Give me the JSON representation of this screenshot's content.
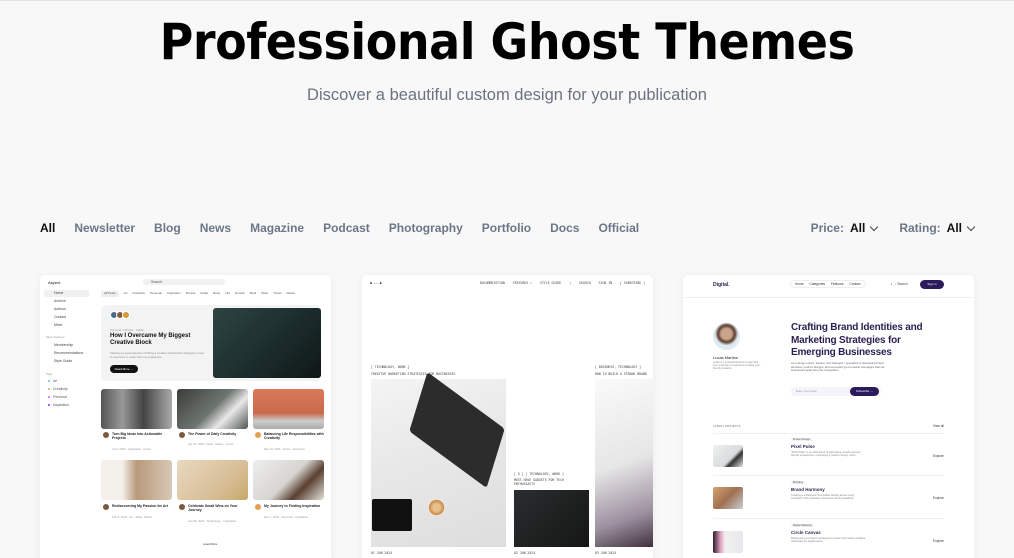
{
  "header": {
    "title": "Professional Ghost Themes",
    "subtitle": "Discover a beautiful custom design for your publication"
  },
  "filters": {
    "categories": [
      "All",
      "Newsletter",
      "Blog",
      "News",
      "Magazine",
      "Podcast",
      "Photography",
      "Portfolio",
      "Docs",
      "Official"
    ],
    "active_category": "All",
    "price": {
      "label": "Price:",
      "value": "All"
    },
    "rating": {
      "label": "Rating:",
      "value": "All"
    }
  },
  "themes": [
    {
      "preview": {
        "logo": "Aspect",
        "search_placeholder": "Search",
        "sidebar": [
          "Home",
          "Archive",
          "Authors",
          "Contact",
          "Mixer"
        ],
        "sidebar_section": "More features",
        "sidebar_features": [
          "Membership",
          "Recommendations",
          "Style Guide"
        ],
        "tags_section": "Tags",
        "tags": [
          "Art",
          "Creativity",
          "Personal",
          "Inspiration"
        ],
        "tabs": [
          "All Posts",
          "Art",
          "Creativity",
          "Personal",
          "Inspiration",
          "Fitness",
          "Dollar",
          "Body",
          "Life",
          "Growth",
          "Mind",
          "Work",
          "Travel",
          "Nature"
        ],
        "featured": {
          "kicker": "Personal · Mindset · Habits",
          "title": "How I Overcame My Biggest Creative Block",
          "desc": "Sharing my personal story of hitting a creative wall and the strategies I used to overcome it. Learn from my experience.",
          "button": "Read More →"
        },
        "posts": [
          {
            "title": "Turn Big Ideas Into Actionable Projects",
            "meta": "Jul 3, 2024 · Inspiration · Focus"
          },
          {
            "title": "The Power of Daily Creativity",
            "meta": "Apr 19, 2024 · Daily · Nature · Focus"
          },
          {
            "title": "Balancing Life Responsibilities with Creativity",
            "meta": "Mar 13, 2024 · Focus · Emotions"
          },
          {
            "title": "Rediscovering My Passion for Art",
            "meta": "Feb 8, 2024 · Art · Skills · Brand"
          },
          {
            "title": "Celebrate Small Wins on Your Journey",
            "meta": "Jan 28, 2024 · Technology · Inspiration"
          },
          {
            "title": "My Journey to Finding Inspiration",
            "meta": "Dec 7, 2023 · Personal · Inspiration"
          }
        ],
        "load_more": "Load More"
      }
    },
    {
      "preview": {
        "nav": [
          "DOCUMENTATION",
          "FEATURES ↓",
          "STYLE GUIDE",
          "SEARCH",
          "SIGN IN",
          "[ SUBSCRIBE ]"
        ],
        "post1_tags": "[ TECHNOLOGY, WORK ]",
        "post1_title": "CREATIVE MARKETING STRATEGIES FOR BUSINESSES",
        "post2_tags": "[ 5 ] [ TECHNOLOGY, WORK ]",
        "post2_title": "MUST-HAVE GADGETS FOR TECH ENTHUSIASTS",
        "post3_tags": "[ BUSINESS, TECHNOLOGY ]",
        "post3_title": "HOW TO BUILD A STRONG BRAND",
        "footers": [
          "01 JUN 2024",
          "02 JUN 2024",
          "03 JUN 2024"
        ]
      }
    },
    {
      "preview": {
        "logo": "Digital.",
        "nav": [
          "Home",
          "Categories",
          "Features",
          "Contact"
        ],
        "search": "Search",
        "signin": "Sign in",
        "author": "Lucas Martins",
        "author_bio": "Lucas is a professional brand expert with over a decade of experience creating user-friendly products.",
        "headline": "Crafting Brand Identities and Marketing Strategies for Emerging Businesses",
        "lead": "As a design expert, advisor, and strategist, I specialize in developing brand identities, product designs, and successful go-to-market campaigns that set businesses apart from the competition.",
        "email_placeholder": "Enter your email",
        "subscribe": "Subscribe →",
        "section": "LATEST PROJECTS",
        "view_all": "View all",
        "projects": [
          {
            "tag": "Product Design",
            "title": "Pixel Pulse",
            "desc": "\"Pixel Pulse\" is an ideal blend of captivating visuals and user-friendly experiences, embodying a modern design vision.",
            "cta": "Explore"
          },
          {
            "tag": "Branding",
            "title": "Brand Harmony",
            "desc": "Creating a unified and memorable identity across every touchpoint with consistent visual and verbal guidelines.",
            "cta": "Explore"
          },
          {
            "tag": "Digital Marketing",
            "title": "Circle Canvas",
            "desc": "Redesigning a content management system that solves workflow challenges for digital teams.",
            "cta": "Explore"
          }
        ]
      }
    }
  ],
  "colors": {
    "accent": "#2c1a5c",
    "muted_text": "#6b7788"
  }
}
